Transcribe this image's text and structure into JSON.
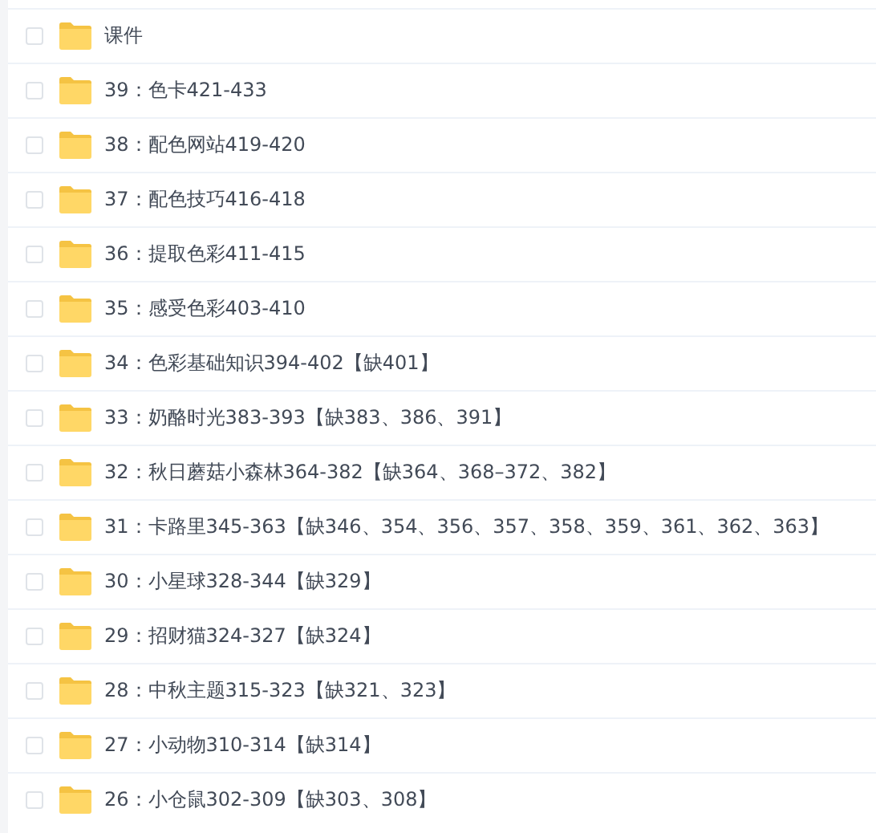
{
  "files": [
    {
      "name": "课件",
      "checked": false
    },
    {
      "name": "39：色卡421-433",
      "checked": false
    },
    {
      "name": "38：配色网站419-420",
      "checked": false
    },
    {
      "name": "37：配色技巧416-418",
      "checked": false
    },
    {
      "name": "36：提取色彩411-415",
      "checked": false
    },
    {
      "name": "35：感受色彩403-410",
      "checked": false
    },
    {
      "name": "34：色彩基础知识394-402【缺401】",
      "checked": false
    },
    {
      "name": "33：奶酪时光383-393【缺383、386、391】",
      "checked": false
    },
    {
      "name": "32：秋日蘑菇小森林364-382【缺364、368–372、382】",
      "checked": false
    },
    {
      "name": "31：卡路里345-363【缺346、354、356、357、358、359、361、362、363】",
      "checked": false
    },
    {
      "name": "30：小星球328-344【缺329】",
      "checked": false
    },
    {
      "name": "29：招财猫324-327【缺324】",
      "checked": false
    },
    {
      "name": "28：中秋主题315-323【缺321、323】",
      "checked": false
    },
    {
      "name": "27：小动物310-314【缺314】",
      "checked": false
    },
    {
      "name": "26：小仓鼠302-309【缺303、308】",
      "checked": false
    }
  ]
}
